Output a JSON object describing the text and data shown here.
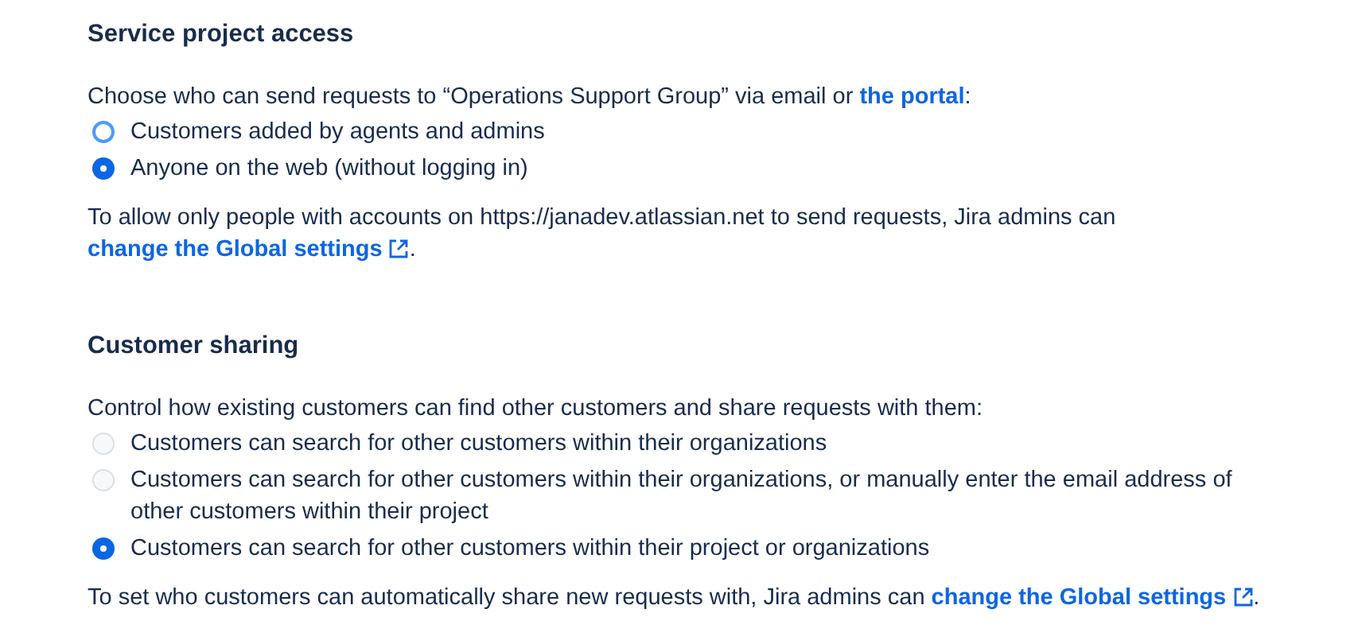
{
  "sections": [
    {
      "title": "Service project access",
      "description": {
        "text": "Choose who can send requests to “Operations Support Group” via email or ",
        "link": "the portal",
        "external": false,
        "after": ":"
      },
      "options": [
        {
          "label": "Customers added by agents and admins",
          "selected": false,
          "disabled": false
        },
        {
          "label": "Anyone on the web (without logging in)",
          "selected": true,
          "disabled": false
        }
      ],
      "note": {
        "text": "To allow only people with accounts on https://janadev.atlassian.net to send requests, Jira admins can ",
        "link": "change the Global settings",
        "external": true,
        "after": "."
      }
    },
    {
      "title": "Customer sharing",
      "description": {
        "text": "Control how existing customers can find other customers and share requests with them:"
      },
      "options": [
        {
          "label": "Customers can search for other customers within their organizations",
          "selected": false,
          "disabled": true
        },
        {
          "label": "Customers can search for other customers within their organizations, or manually enter the email address of other customers within their project",
          "selected": false,
          "disabled": true
        },
        {
          "label": "Customers can search for other customers within their project or organizations",
          "selected": true,
          "disabled": false
        }
      ],
      "note": {
        "text": "To set who customers can automatically share new requests with, Jira admins can ",
        "link": "change the Global settings",
        "external": true,
        "after": "."
      }
    }
  ]
}
